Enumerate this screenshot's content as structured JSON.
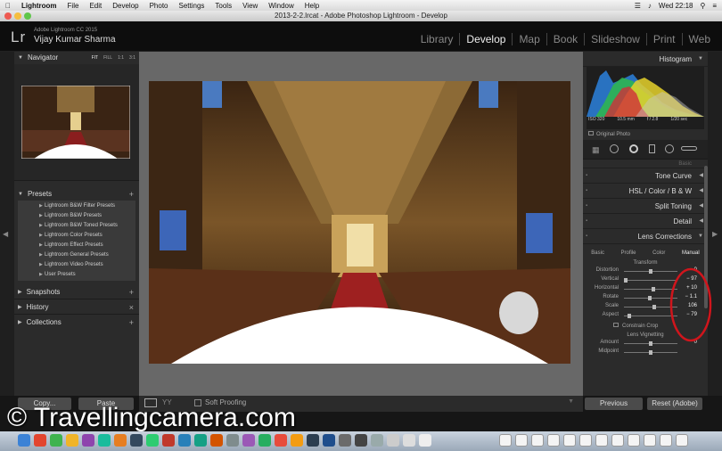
{
  "menu": {
    "apple": "",
    "items": [
      "Lightroom",
      "File",
      "Edit",
      "Develop",
      "Photo",
      "Settings",
      "Tools",
      "View",
      "Window",
      "Help"
    ],
    "clock": "Wed 22:18"
  },
  "window": {
    "title": "2013-2-2.lrcat - Adobe Photoshop Lightroom - Develop"
  },
  "identity": {
    "version": "Adobe Lightroom CC 2015",
    "name": "Vijay Kumar Sharma",
    "logo": "Lr"
  },
  "modules": [
    "Library",
    "Develop",
    "Map",
    "Book",
    "Slideshow",
    "Print",
    "Web"
  ],
  "left_panel": {
    "navigator": {
      "title": "Navigator",
      "zoom": [
        "FIT",
        "FILL",
        "1:1",
        "3:1"
      ]
    },
    "presets": {
      "title": "Presets",
      "items": [
        "Lightroom B&W Filter Presets",
        "Lightroom B&W Presets",
        "Lightroom B&W Toned Presets",
        "Lightroom Color Presets",
        "Lightroom Effect Presets",
        "Lightroom General Presets",
        "Lightroom Video Presets",
        "User Presets"
      ]
    },
    "snapshots": "Snapshots",
    "history": "History",
    "collections": "Collections"
  },
  "toolbar": {
    "soft_proofing": "Soft Proofing"
  },
  "buttons": {
    "copy": "Copy...",
    "paste": "Paste",
    "previous": "Previous",
    "reset": "Reset (Adobe)"
  },
  "right_panel": {
    "histogram": {
      "title": "Histogram",
      "iso": "ISO 320",
      "focal": "10.5 mm",
      "aperture": "f / 2.8",
      "shutter": "1/20 sec",
      "original": "Original Photo"
    },
    "sections": [
      "Basic",
      "Tone Curve",
      "HSL / Color / B & W",
      "Split Toning",
      "Detail",
      "Lens Corrections"
    ],
    "lens_tabs": [
      "Basic",
      "Profile",
      "Color",
      "Manual"
    ],
    "transform": {
      "title": "Transform",
      "sliders": [
        {
          "label": "Distortion",
          "value": "0",
          "pos": 0.5
        },
        {
          "label": "Vertical",
          "value": "− 97",
          "pos": 0.03
        },
        {
          "label": "Horizontal",
          "value": "+ 10",
          "pos": 0.55
        },
        {
          "label": "Rotate",
          "value": "− 1.1",
          "pos": 0.48
        },
        {
          "label": "Scale",
          "value": "106",
          "pos": 0.56
        },
        {
          "label": "Aspect",
          "value": "− 79",
          "pos": 0.1
        }
      ],
      "constrain": "Constrain Crop"
    },
    "vignetting": {
      "title": "Lens Vignetting",
      "sliders": [
        {
          "label": "Amount",
          "value": "0",
          "pos": 0.5
        },
        {
          "label": "Midpoint",
          "value": "",
          "pos": 0.5
        }
      ]
    }
  },
  "watermark": "© Travellingcamera.com",
  "colors": {
    "annotation": "#d0151c",
    "accent": "#eeeeee"
  }
}
